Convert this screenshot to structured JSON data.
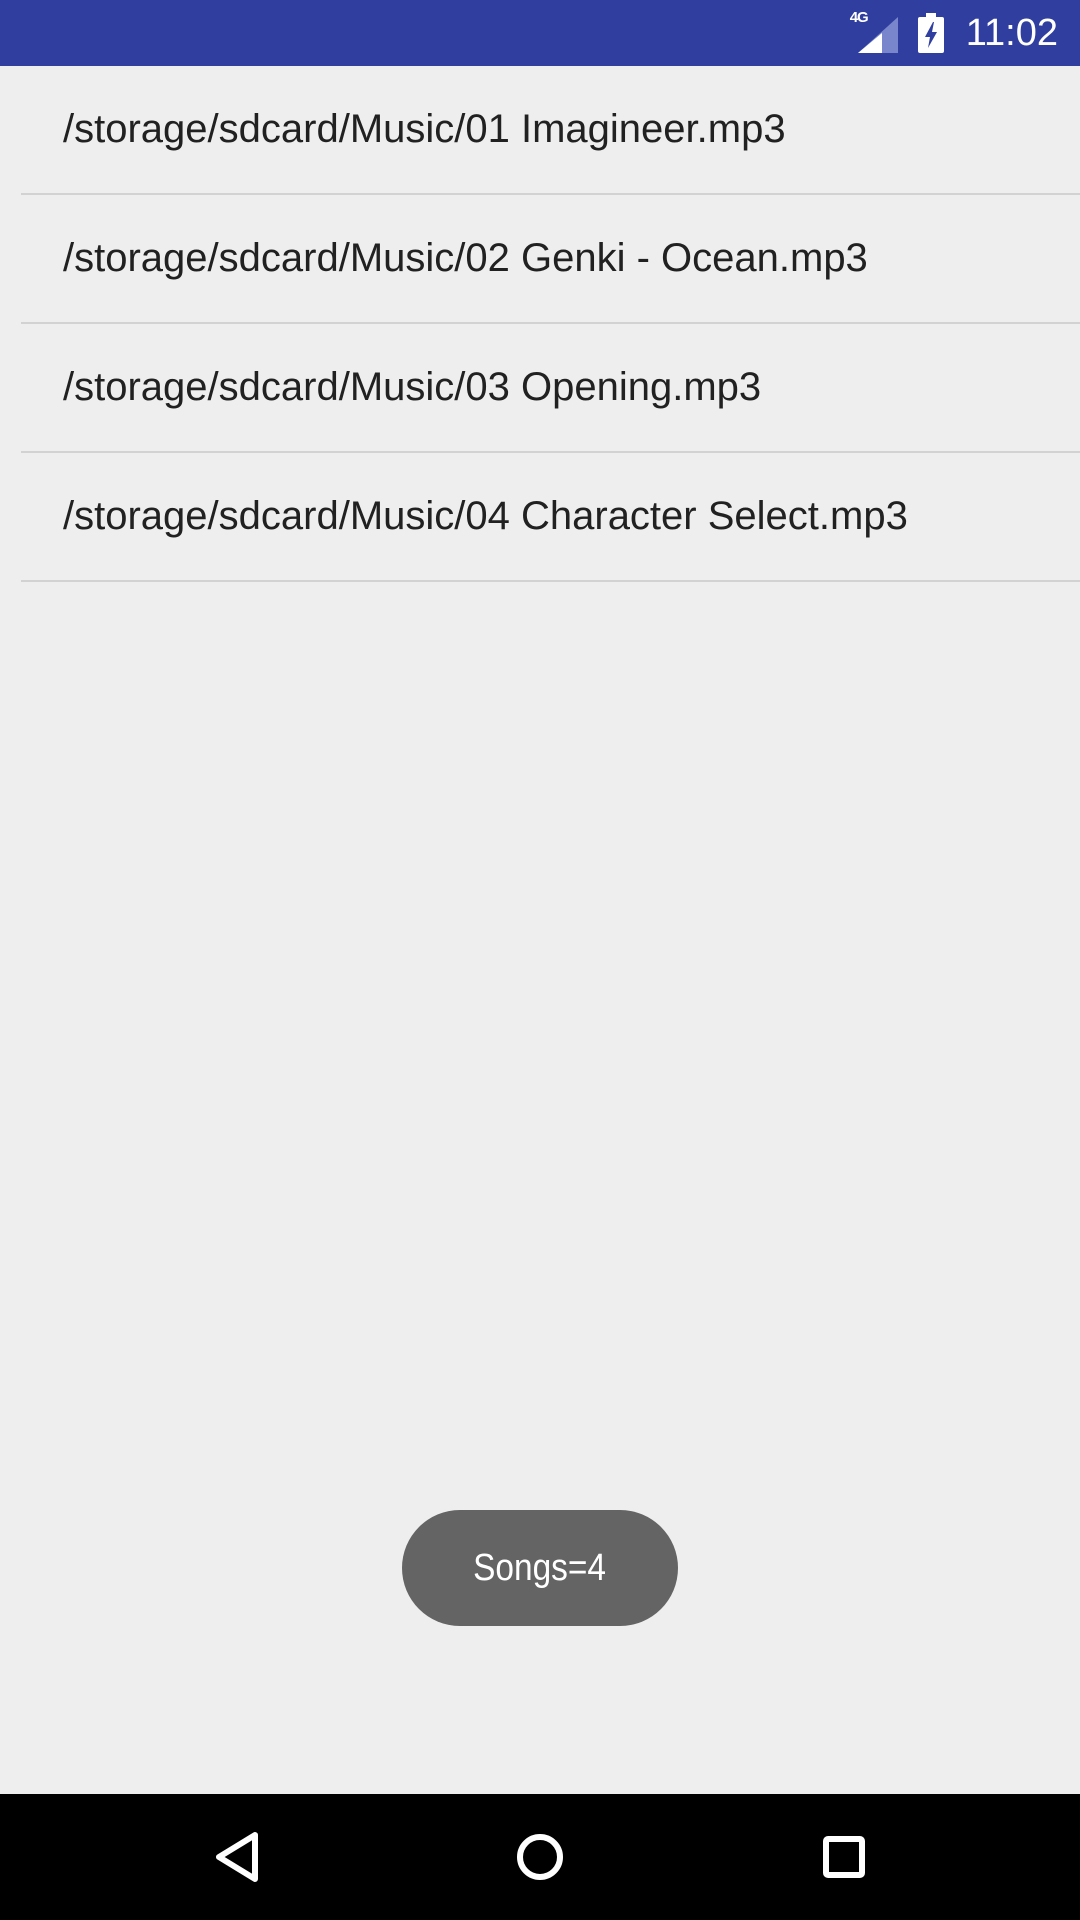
{
  "status_bar": {
    "network_type": "4G",
    "time": "11:02",
    "background_color": "#303f9f"
  },
  "songs": [
    {
      "path": "/storage/sdcard/Music/01 Imagineer.mp3"
    },
    {
      "path": "/storage/sdcard/Music/02 Genki - Ocean.mp3"
    },
    {
      "path": "/storage/sdcard/Music/03 Opening.mp3"
    },
    {
      "path": "/storage/sdcard/Music/04 Character Select.mp3"
    }
  ],
  "toast": {
    "text": "Songs=4"
  },
  "nav_bar": {
    "buttons": [
      "back-icon",
      "home-icon",
      "recents-icon"
    ]
  }
}
